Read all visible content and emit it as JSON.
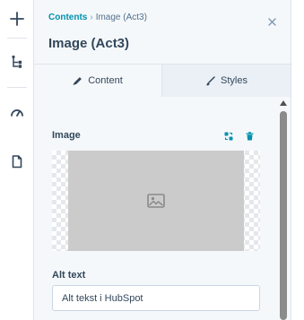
{
  "rail": {
    "icons": [
      "plus-icon",
      "tree-structure-icon",
      "speedometer-icon",
      "document-icon"
    ]
  },
  "panel": {
    "breadcrumb": {
      "parent": "Contents",
      "separator": "›",
      "current": "Image (Act3)"
    },
    "title": "Image (Act3)",
    "close_icon": "close-icon"
  },
  "tabs": [
    {
      "label": "Content",
      "icon": "pencil-icon",
      "active": true
    },
    {
      "label": "Styles",
      "icon": "brush-icon",
      "active": false
    }
  ],
  "image_field": {
    "label": "Image",
    "actions": [
      "replace-image-icon",
      "trash-icon"
    ],
    "placeholder_icon": "image-placeholder-icon"
  },
  "alt_field": {
    "label": "Alt text",
    "value": "Alt tekst i HubSpot"
  },
  "colors": {
    "link": "#0091ae",
    "text": "#33475b",
    "panel_bg": "#f5f8fa",
    "inactive_tab_bg": "#eaf0f6",
    "placeholder_bg": "#cbcbcb"
  }
}
